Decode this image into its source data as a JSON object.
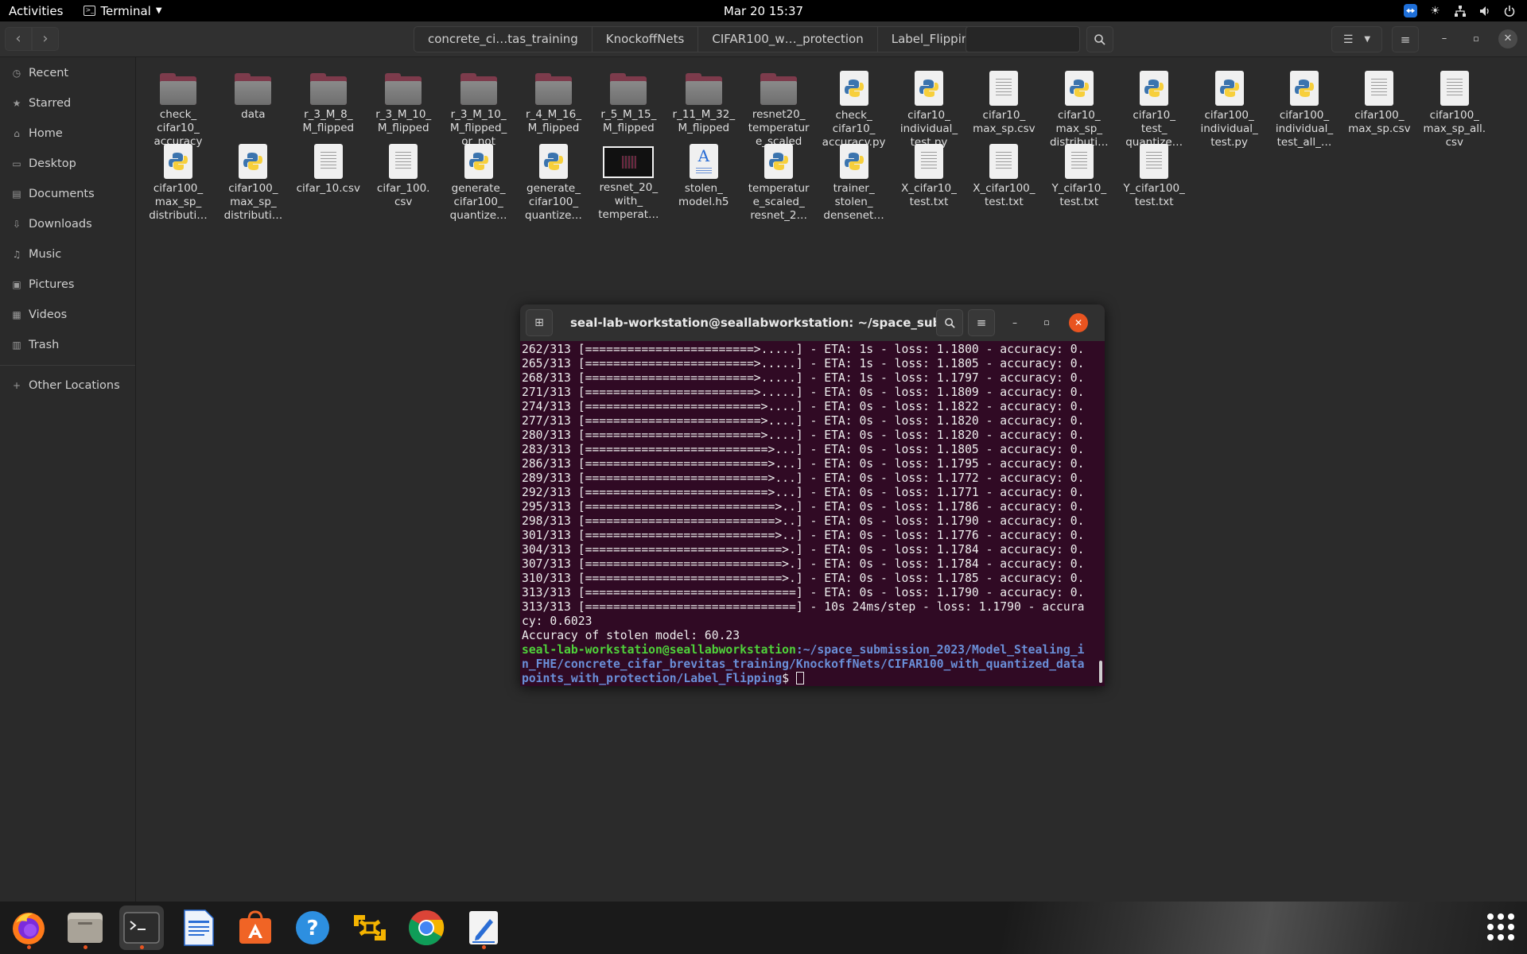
{
  "topbar": {
    "activities": "Activities",
    "app_name": "Terminal",
    "clock": "Mar 20  15:37"
  },
  "files": {
    "back_icon": "chevron-left-icon",
    "forward_icon": "chevron-right-icon",
    "breadcrumbs": [
      "concrete_ci…tas_training",
      "KnockoffNets",
      "CIFAR100_w…_protection",
      "Label_Flipping"
    ],
    "sidebar": [
      {
        "label": "Recent",
        "icon": "clock-icon"
      },
      {
        "label": "Starred",
        "icon": "star-icon"
      },
      {
        "label": "Home",
        "icon": "home-icon"
      },
      {
        "label": "Desktop",
        "icon": "desktop-icon"
      },
      {
        "label": "Documents",
        "icon": "documents-icon"
      },
      {
        "label": "Downloads",
        "icon": "download-icon"
      },
      {
        "label": "Music",
        "icon": "music-icon"
      },
      {
        "label": "Pictures",
        "icon": "pictures-icon"
      },
      {
        "label": "Videos",
        "icon": "videos-icon"
      },
      {
        "label": "Trash",
        "icon": "trash-icon"
      },
      {
        "label": "Other Locations",
        "icon": "plus-icon"
      }
    ],
    "items": [
      {
        "label": "check_\ncifar10_\naccuracy",
        "type": "folder"
      },
      {
        "label": "data",
        "type": "folder"
      },
      {
        "label": "r_3_M_8_\nM_flipped",
        "type": "folder"
      },
      {
        "label": "r_3_M_10_\nM_flipped",
        "type": "folder"
      },
      {
        "label": "r_3_M_10_\nM_flipped_\nor_not",
        "type": "folder"
      },
      {
        "label": "r_4_M_16_\nM_flipped",
        "type": "folder"
      },
      {
        "label": "r_5_M_15_\nM_flipped",
        "type": "folder"
      },
      {
        "label": "r_11_M_32_\nM_flipped",
        "type": "folder"
      },
      {
        "label": "resnet20_\ntemperatur\ne_scaled",
        "type": "folder"
      },
      {
        "label": "check_\ncifar10_\naccuracy.py",
        "type": "python"
      },
      {
        "label": "cifar10_\nindividual_\ntest.py",
        "type": "python"
      },
      {
        "label": "cifar10_\nmax_sp.csv",
        "type": "text"
      },
      {
        "label": "cifar10_\nmax_sp_\ndistributi…",
        "type": "python"
      },
      {
        "label": "cifar10_\ntest_\nquantize…",
        "type": "python"
      },
      {
        "label": "cifar100_\nindividual_\ntest.py",
        "type": "python"
      },
      {
        "label": "cifar100_\nindividual_\ntest_all_…",
        "type": "python"
      },
      {
        "label": "cifar100_\nmax_sp.csv",
        "type": "text"
      },
      {
        "label": "cifar100_\nmax_sp_all.\ncsv",
        "type": "text"
      },
      {
        "label": "cifar100_\nmax_sp_\ndistributi…",
        "type": "python"
      },
      {
        "label": "cifar100_\nmax_sp_\ndistributi…",
        "type": "python"
      },
      {
        "label": "cifar_10.csv",
        "type": "text"
      },
      {
        "label": "cifar_100.\ncsv",
        "type": "text"
      },
      {
        "label": "generate_\ncifar100_\nquantize…",
        "type": "python"
      },
      {
        "label": "generate_\ncifar100_\nquantize…",
        "type": "python"
      },
      {
        "label": "resnet_20_\nwith_\ntemperat…",
        "type": "image"
      },
      {
        "label": "stolen_\nmodel.h5",
        "type": "h5"
      },
      {
        "label": "temperatur\ne_scaled_\nresnet_2…",
        "type": "python"
      },
      {
        "label": "trainer_\nstolen_\ndensenet…",
        "type": "python"
      },
      {
        "label": "X_cifar10_\ntest.txt",
        "type": "text"
      },
      {
        "label": "X_cifar100_\ntest.txt",
        "type": "text"
      },
      {
        "label": "Y_cifar10_\ntest.txt",
        "type": "text"
      },
      {
        "label": "Y_cifar100_\ntest.txt",
        "type": "text"
      }
    ]
  },
  "terminal": {
    "title": "seal-lab-workstation@seallabworkstation: ~/space_submissi…",
    "lines": [
      "262/313 [========================>.....] - ETA: 1s - loss: 1.1800 - accuracy: 0.",
      "265/313 [========================>.....] - ETA: 1s - loss: 1.1805 - accuracy: 0.",
      "268/313 [========================>.....] - ETA: 1s - loss: 1.1797 - accuracy: 0.",
      "271/313 [========================>.....] - ETA: 0s - loss: 1.1809 - accuracy: 0.",
      "274/313 [=========================>....] - ETA: 0s - loss: 1.1822 - accuracy: 0.",
      "277/313 [=========================>....] - ETA: 0s - loss: 1.1820 - accuracy: 0.",
      "280/313 [=========================>....] - ETA: 0s - loss: 1.1820 - accuracy: 0.",
      "283/313 [==========================>...] - ETA: 0s - loss: 1.1805 - accuracy: 0.",
      "286/313 [==========================>...] - ETA: 0s - loss: 1.1795 - accuracy: 0.",
      "289/313 [==========================>...] - ETA: 0s - loss: 1.1772 - accuracy: 0.",
      "292/313 [==========================>...] - ETA: 0s - loss: 1.1771 - accuracy: 0.",
      "295/313 [===========================>..] - ETA: 0s - loss: 1.1786 - accuracy: 0.",
      "298/313 [===========================>..] - ETA: 0s - loss: 1.1790 - accuracy: 0.",
      "301/313 [===========================>..] - ETA: 0s - loss: 1.1776 - accuracy: 0.",
      "304/313 [============================>.] - ETA: 0s - loss: 1.1784 - accuracy: 0.",
      "307/313 [============================>.] - ETA: 0s - loss: 1.1784 - accuracy: 0.",
      "310/313 [============================>.] - ETA: 0s - loss: 1.1785 - accuracy: 0.",
      "313/313 [==============================] - ETA: 0s - loss: 1.1790 - accuracy: 0.",
      "313/313 [==============================] - 10s 24ms/step - loss: 1.1790 - accura",
      "cy: 0.6023",
      "Accuracy of stolen model: 60.23"
    ],
    "prompt_user": "seal-lab-workstation@seallabworkstation",
    "prompt_path_lines": [
      ":~/space_submission_2023/Model_Stealing_i",
      "n_FHE/concrete_cifar_brevitas_training/KnockoffNets/CIFAR100_with_quantized_data",
      "points_with_protection/Label_Flipping"
    ],
    "prompt_symbol": "$ "
  },
  "dock": [
    {
      "name": "firefox",
      "icon": "firefox-icon",
      "running": true
    },
    {
      "name": "files",
      "icon": "files-icon",
      "running": true
    },
    {
      "name": "terminal",
      "icon": "terminal-icon",
      "running": true,
      "active": true
    },
    {
      "name": "writer",
      "icon": "libreoffice-writer-icon",
      "running": false
    },
    {
      "name": "software",
      "icon": "software-store-icon",
      "running": false
    },
    {
      "name": "help",
      "icon": "help-icon",
      "running": false
    },
    {
      "name": "vmware",
      "icon": "vmware-icon",
      "running": false
    },
    {
      "name": "chrome",
      "icon": "chrome-icon",
      "running": false
    },
    {
      "name": "text-editor",
      "icon": "text-editor-icon",
      "running": true
    }
  ],
  "colors": {
    "terminal_bg": "#300a24",
    "prompt_user": "#4fd23a",
    "prompt_path": "#6a8fd8",
    "accent": "#e95420",
    "close_button": "#e95420",
    "folder_tab": "#7d3a4b"
  }
}
